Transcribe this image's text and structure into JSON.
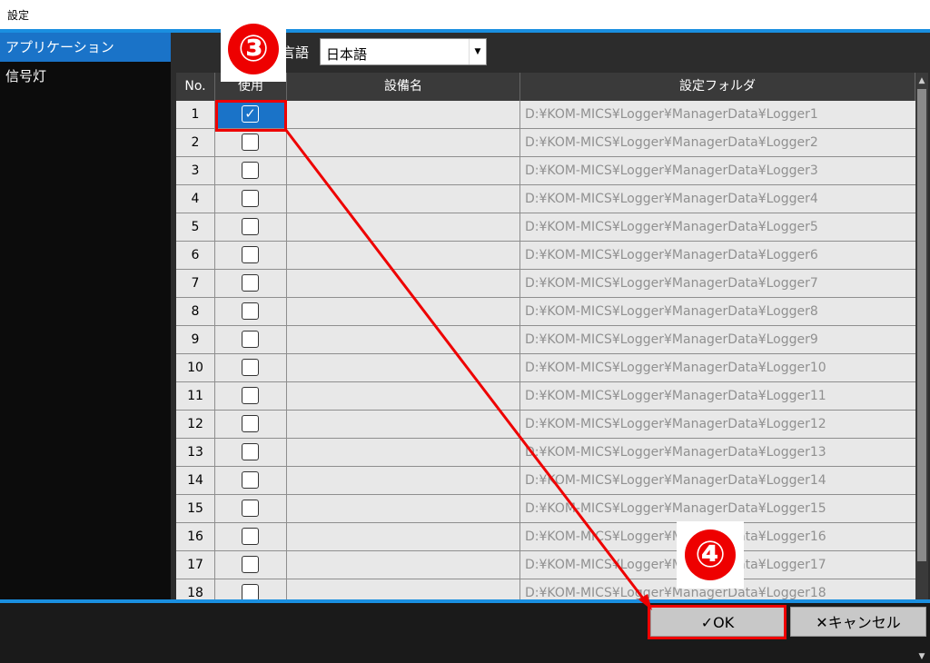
{
  "window": {
    "title": "設定"
  },
  "sidebar": {
    "items": [
      {
        "label": "アプリケーション",
        "active": true
      },
      {
        "label": "信号灯",
        "active": false
      }
    ]
  },
  "language": {
    "label": "言語",
    "value": "日本語"
  },
  "table": {
    "headers": [
      "No.",
      "使用",
      "設備名",
      "設定フォルダ"
    ],
    "rows": [
      {
        "no": "1",
        "checked": true,
        "name": "",
        "folder": "D:¥KOM-MICS¥Logger¥ManagerData¥Logger1"
      },
      {
        "no": "2",
        "checked": false,
        "name": "",
        "folder": "D:¥KOM-MICS¥Logger¥ManagerData¥Logger2"
      },
      {
        "no": "3",
        "checked": false,
        "name": "",
        "folder": "D:¥KOM-MICS¥Logger¥ManagerData¥Logger3"
      },
      {
        "no": "4",
        "checked": false,
        "name": "",
        "folder": "D:¥KOM-MICS¥Logger¥ManagerData¥Logger4"
      },
      {
        "no": "5",
        "checked": false,
        "name": "",
        "folder": "D:¥KOM-MICS¥Logger¥ManagerData¥Logger5"
      },
      {
        "no": "6",
        "checked": false,
        "name": "",
        "folder": "D:¥KOM-MICS¥Logger¥ManagerData¥Logger6"
      },
      {
        "no": "7",
        "checked": false,
        "name": "",
        "folder": "D:¥KOM-MICS¥Logger¥ManagerData¥Logger7"
      },
      {
        "no": "8",
        "checked": false,
        "name": "",
        "folder": "D:¥KOM-MICS¥Logger¥ManagerData¥Logger8"
      },
      {
        "no": "9",
        "checked": false,
        "name": "",
        "folder": "D:¥KOM-MICS¥Logger¥ManagerData¥Logger9"
      },
      {
        "no": "10",
        "checked": false,
        "name": "",
        "folder": "D:¥KOM-MICS¥Logger¥ManagerData¥Logger10"
      },
      {
        "no": "11",
        "checked": false,
        "name": "",
        "folder": "D:¥KOM-MICS¥Logger¥ManagerData¥Logger11"
      },
      {
        "no": "12",
        "checked": false,
        "name": "",
        "folder": "D:¥KOM-MICS¥Logger¥ManagerData¥Logger12"
      },
      {
        "no": "13",
        "checked": false,
        "name": "",
        "folder": "D:¥KOM-MICS¥Logger¥ManagerData¥Logger13"
      },
      {
        "no": "14",
        "checked": false,
        "name": "",
        "folder": "D:¥KOM-MICS¥Logger¥ManagerData¥Logger14"
      },
      {
        "no": "15",
        "checked": false,
        "name": "",
        "folder": "D:¥KOM-MICS¥Logger¥ManagerData¥Logger15"
      },
      {
        "no": "16",
        "checked": false,
        "name": "",
        "folder": "D:¥KOM-MICS¥Logger¥ManagerData¥Logger16"
      },
      {
        "no": "17",
        "checked": false,
        "name": "",
        "folder": "D:¥KOM-MICS¥Logger¥ManagerData¥Logger17"
      },
      {
        "no": "18",
        "checked": false,
        "name": "",
        "folder": "D:¥KOM-MICS¥Logger¥ManagerData¥Logger18"
      }
    ]
  },
  "buttons": {
    "ok": "✓OK",
    "cancel": "✕キャンセル"
  },
  "annotations": {
    "step3": "③",
    "step4": "④"
  },
  "colors": {
    "accent": "#1a8fe0",
    "selection": "#1a73c8",
    "highlight": "#e00000"
  }
}
